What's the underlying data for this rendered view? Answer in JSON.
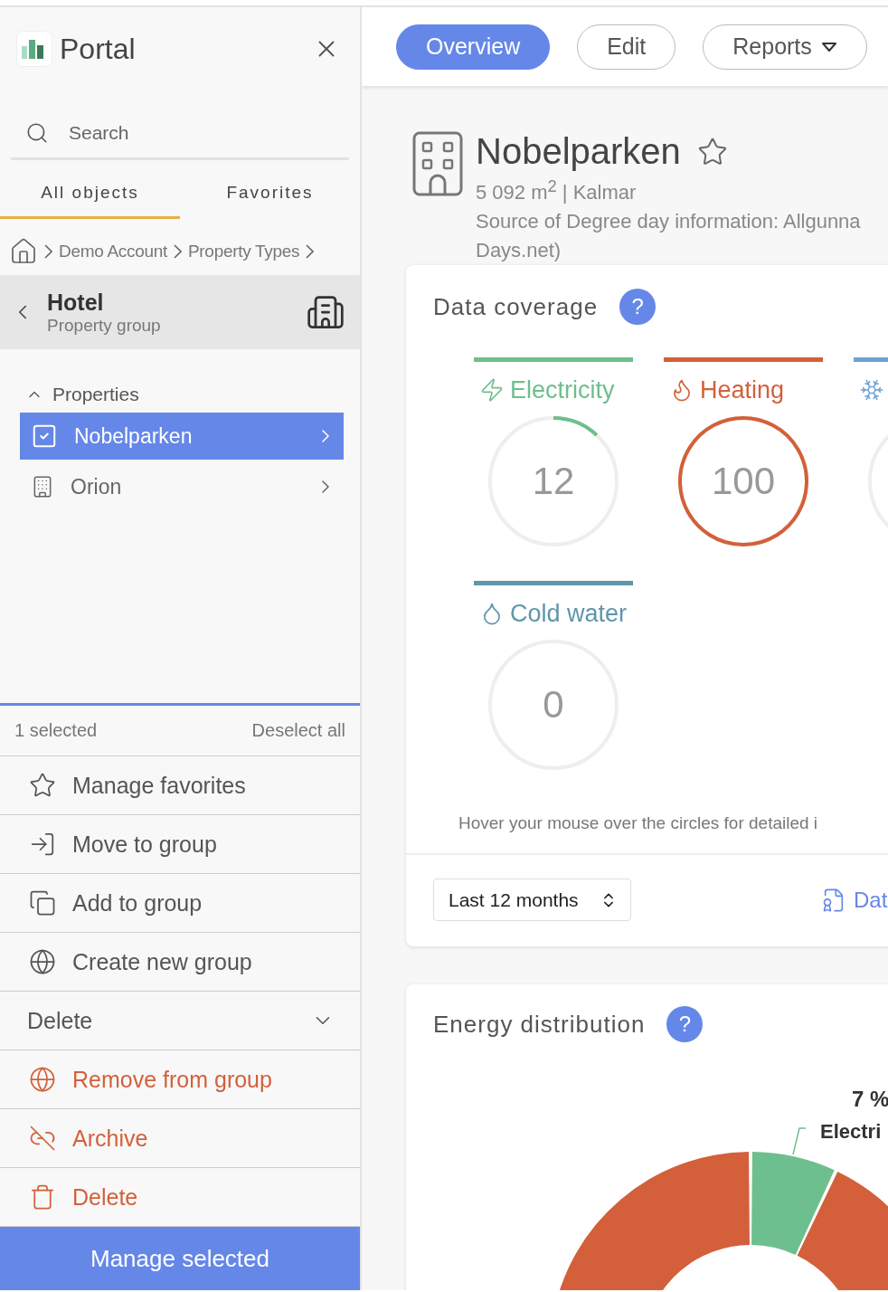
{
  "sidebar": {
    "title": "Portal",
    "search": {
      "placeholder": "Search"
    },
    "tabs": [
      {
        "label": "All objects",
        "selected": true
      },
      {
        "label": "Favorites",
        "selected": false
      }
    ],
    "breadcrumb": [
      "Demo Account",
      "Property Types"
    ],
    "group": {
      "name": "Hotel",
      "type": "Property group"
    },
    "properties": {
      "label": "Properties",
      "expanded": true,
      "items": [
        {
          "name": "Nobelparken",
          "selected": true
        },
        {
          "name": "Orion",
          "selected": false
        }
      ]
    },
    "selection": {
      "count": "1 selected",
      "clear": "Deselect all"
    },
    "actions": [
      {
        "kind": "action",
        "label": "Manage favorites"
      },
      {
        "kind": "action",
        "label": "Move to group"
      },
      {
        "kind": "action",
        "label": "Add to group"
      },
      {
        "kind": "action",
        "label": "Create new group"
      },
      {
        "kind": "section",
        "label": "Delete",
        "expanded": true
      },
      {
        "kind": "danger",
        "label": "Remove from group"
      },
      {
        "kind": "danger",
        "label": "Archive"
      },
      {
        "kind": "danger",
        "label": "Delete"
      }
    ],
    "manage_button": "Manage selected"
  },
  "nav": [
    {
      "kind": "button",
      "label": "Overview",
      "selected": true
    },
    {
      "kind": "button",
      "label": "Edit",
      "selected": false
    },
    {
      "kind": "dropdown",
      "label": "Reports",
      "selected": false
    }
  ],
  "property": {
    "name": "Nobelparken",
    "area": "5 092 m$^{2}$ | Kalmar",
    "source": [
      "Source of Degree day information: Allgunna",
      "Days.net)"
    ]
  },
  "coverage": {
    "title": "Data coverage",
    "help": "?",
    "meters": [
      {
        "kind": "electricity",
        "label": "Electricity",
        "value": "12",
        "level": 0.12,
        "color": "#6dbf8e"
      },
      {
        "kind": "heating",
        "label": "Heating",
        "value": "100",
        "level": 1,
        "color": "#d3603a"
      },
      {
        "kind": "cooling",
        "color": "#6fa3d3"
      },
      {
        "kind": "water",
        "label": "Cold water",
        "value": "0",
        "color": "#5f95ad"
      }
    ],
    "hint": "Hover your mouse over the circles for detailed i",
    "period": "Last 12 months",
    "link": "Dat"
  },
  "distribution": {
    "title": "Energy distribution",
    "help": "?",
    "slice_label": {
      "share": "7 %",
      "name": "Electri"
    }
  }
}
